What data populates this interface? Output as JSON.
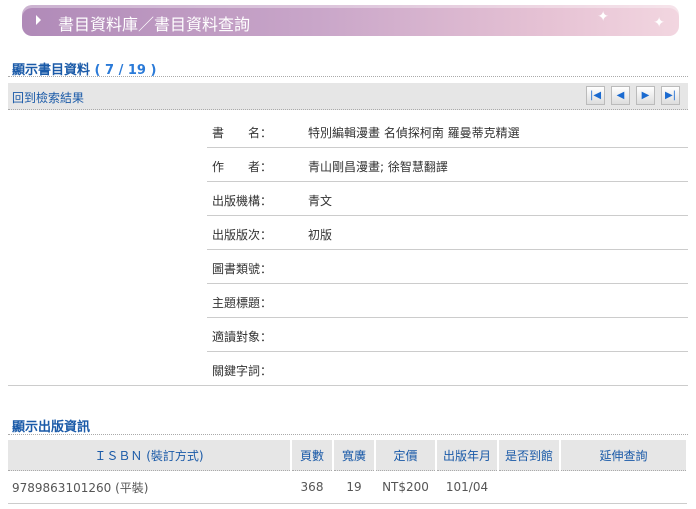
{
  "banner": {
    "title": "書目資料庫／書目資料查詢"
  },
  "section1": {
    "title": "顯示書目資料",
    "count": "( 7 / 19 )"
  },
  "nav": {
    "back": "回到檢索結果",
    "first": "|◀",
    "prev": "◀",
    "next": "▶",
    "last": "▶|"
  },
  "fields": [
    {
      "label": "書　　名：",
      "value": "特別編輯漫畫 名偵探柯南 羅曼蒂克精選"
    },
    {
      "label": "作　　者：",
      "value": "青山剛昌漫畫; 徐智慧翻譯"
    },
    {
      "label": "出版機構：",
      "value": "青文"
    },
    {
      "label": "出版版次：",
      "value": "初版"
    },
    {
      "label": "圖書類號：",
      "value": ""
    },
    {
      "label": "主題標題：",
      "value": ""
    },
    {
      "label": "適讀對象：",
      "value": ""
    },
    {
      "label": "關鍵字詞：",
      "value": ""
    }
  ],
  "section2": {
    "title": "顯示出版資訊"
  },
  "pubtable": {
    "headers": [
      "ＩＳＢＮ (裝訂方式)",
      "頁數",
      "寬廣",
      "定價",
      "出版年月",
      "是否到館",
      "延伸查詢"
    ],
    "rows": [
      [
        "9789863101260 (平裝)",
        "368",
        "19",
        "NT$200",
        "101/04",
        "",
        ""
      ]
    ]
  }
}
